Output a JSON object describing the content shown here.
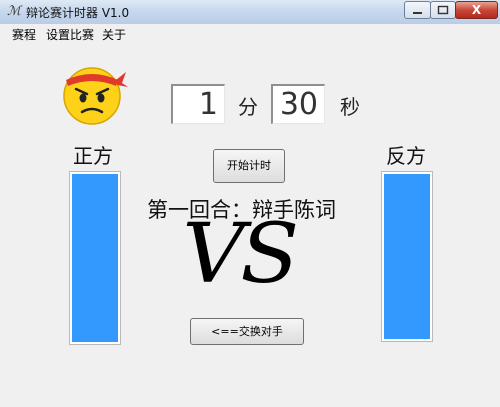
{
  "window": {
    "title": "辩论赛计时器 V1.0",
    "close_glyph": "X"
  },
  "menu": {
    "items": [
      {
        "label": "赛程"
      },
      {
        "label": "设置比赛"
      },
      {
        "label": "关于"
      }
    ]
  },
  "timer": {
    "minutes": "1",
    "minute_unit": "分",
    "seconds": "30",
    "second_unit": "秒"
  },
  "controls": {
    "start_label": "开始计时",
    "swap_label": "<==交换对手"
  },
  "sides": {
    "left_label": "正方",
    "right_label": "反方",
    "left_bar_level": 1.0,
    "right_bar_level": 1.0,
    "bar_color": "#3399ff"
  },
  "round": {
    "text": "第一回合：辩手陈词",
    "vs": "VS"
  },
  "icons": {
    "app": "app-logo-icon",
    "avatar": "angry-face-headband-avatar"
  }
}
